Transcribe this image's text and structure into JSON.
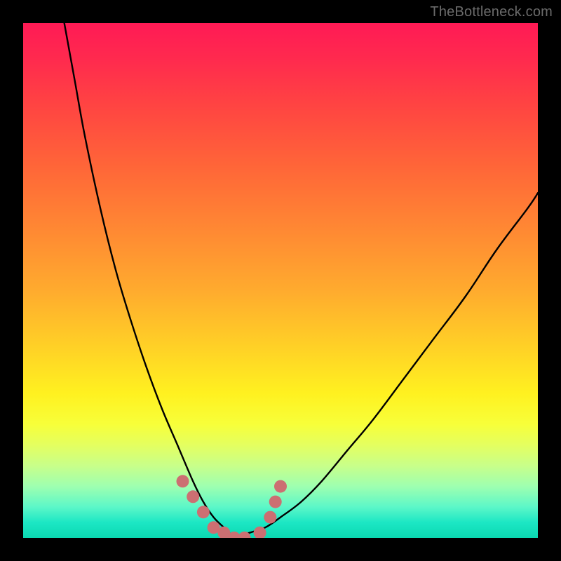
{
  "watermark": {
    "text": "TheBottleneck.com"
  },
  "colors": {
    "curve": "#000000",
    "marker": "#cc6f72",
    "gradient_stops": [
      "#ff1a55",
      "#ff4442",
      "#ff8833",
      "#ffd126",
      "#fff120",
      "#c8ff8a",
      "#1ce7c4"
    ]
  },
  "chart_data": {
    "type": "line",
    "title": "",
    "xlabel": "",
    "ylabel": "",
    "xlim": [
      0,
      100
    ],
    "ylim": [
      0,
      100
    ],
    "grid": false,
    "legend": false,
    "annotations": [
      "TheBottleneck.com"
    ],
    "series": [
      {
        "name": "bottleneck-curve-left",
        "x": [
          8,
          10,
          12,
          15,
          18,
          21,
          24,
          27,
          30,
          33,
          35,
          37,
          39,
          41
        ],
        "y": [
          100,
          89,
          78,
          64,
          52,
          42,
          33,
          25,
          18,
          11,
          7,
          4,
          2,
          0
        ]
      },
      {
        "name": "bottleneck-curve-right",
        "x": [
          41,
          44,
          47,
          50,
          54,
          58,
          63,
          68,
          74,
          80,
          86,
          92,
          98,
          100
        ],
        "y": [
          0,
          1,
          2,
          4,
          7,
          11,
          17,
          23,
          31,
          39,
          47,
          56,
          64,
          67
        ]
      },
      {
        "name": "optimal-zone-markers",
        "type": "scatter",
        "x": [
          31,
          33,
          35,
          37,
          39,
          41,
          43,
          46,
          48,
          49,
          50
        ],
        "y": [
          11,
          8,
          5,
          2,
          1,
          0,
          0,
          1,
          4,
          7,
          10
        ]
      }
    ]
  }
}
